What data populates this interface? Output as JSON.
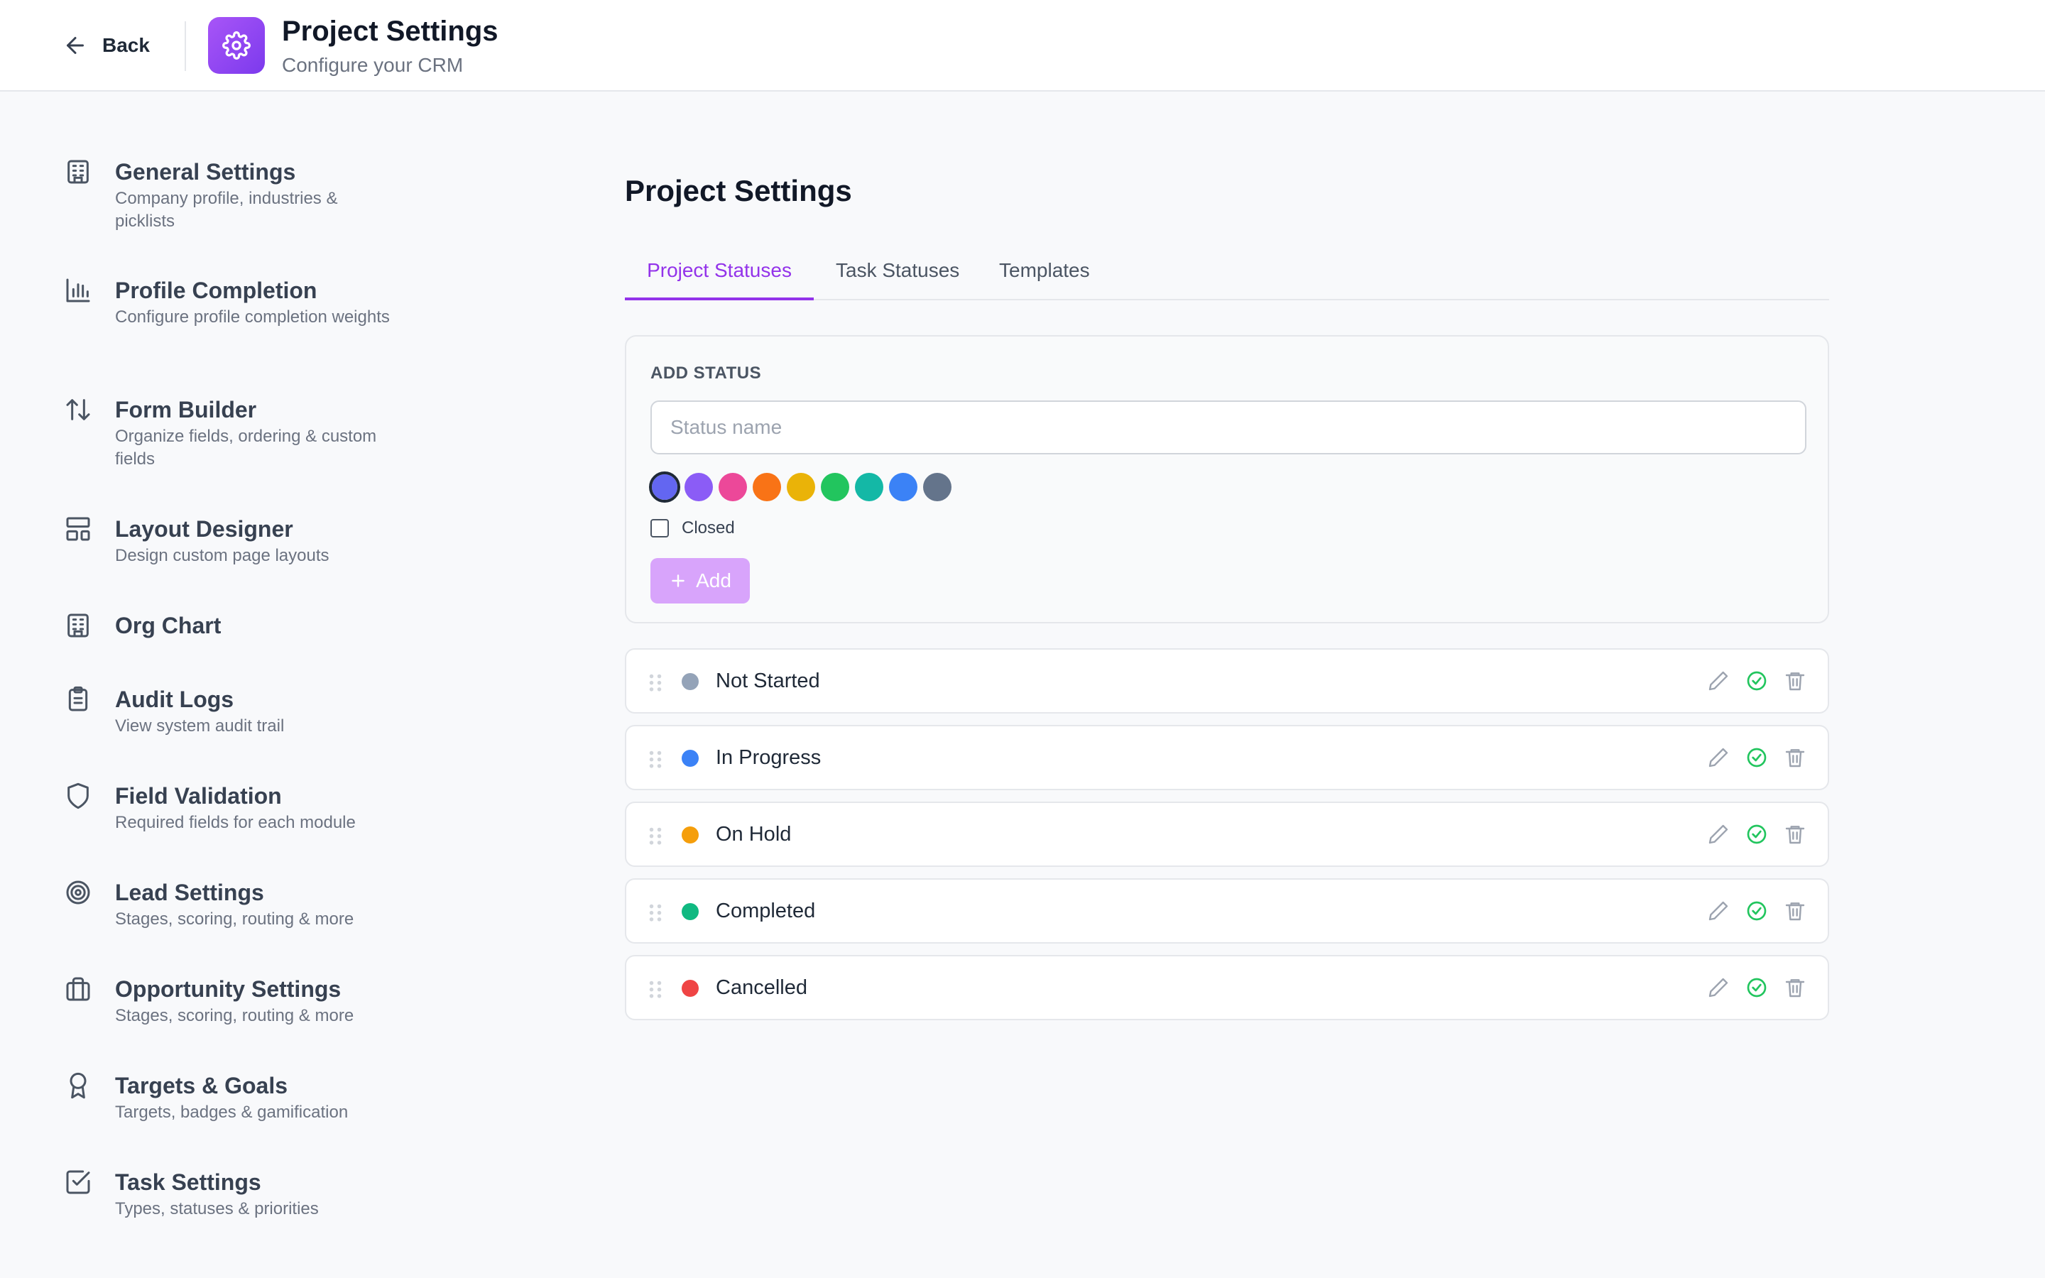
{
  "header": {
    "back_label": "Back",
    "title": "Project Settings",
    "subtitle": "Configure your CRM",
    "app_icon": "gear-icon"
  },
  "sidebar": {
    "items": [
      {
        "icon": "building-icon",
        "title": "General Settings",
        "desc": "Company profile, industries & picklists"
      },
      {
        "icon": "bar-chart-icon",
        "title": "Profile Completion",
        "desc": "Configure profile completion weights"
      },
      {
        "icon": "sort-arrows-icon",
        "title": "Form Builder",
        "desc": "Organize fields, ordering & custom fields"
      },
      {
        "icon": "layout-icon",
        "title": "Layout Designer",
        "desc": "Design custom page layouts"
      },
      {
        "icon": "building-icon",
        "title": "Org Chart",
        "desc": ""
      },
      {
        "icon": "clipboard-icon",
        "title": "Audit Logs",
        "desc": "View system audit trail"
      },
      {
        "icon": "shield-icon",
        "title": "Field Validation",
        "desc": "Required fields for each module"
      },
      {
        "icon": "target-icon",
        "title": "Lead Settings",
        "desc": "Stages, scoring, routing & more"
      },
      {
        "icon": "briefcase-icon",
        "title": "Opportunity Settings",
        "desc": "Stages, scoring, routing & more"
      },
      {
        "icon": "award-icon",
        "title": "Targets & Goals",
        "desc": "Targets, badges & gamification"
      },
      {
        "icon": "checkbox-icon",
        "title": "Task Settings",
        "desc": "Types, statuses & priorities"
      }
    ]
  },
  "main": {
    "title": "Project Settings",
    "tabs": [
      {
        "label": "Project Statuses",
        "active": true
      },
      {
        "label": "Task Statuses",
        "active": false
      },
      {
        "label": "Templates",
        "active": false
      }
    ],
    "add_status": {
      "label": "ADD STATUS",
      "placeholder": "Status name",
      "value": "",
      "colors": [
        "#6366f1",
        "#8b5cf6",
        "#ec4899",
        "#f97316",
        "#eab308",
        "#22c55e",
        "#14b8a6",
        "#3b82f6",
        "#64748b"
      ],
      "selected_color": "#6366f1",
      "closed_label": "Closed",
      "closed_checked": false,
      "add_label": "Add"
    },
    "statuses": [
      {
        "name": "Not Started",
        "color": "#94a3b8"
      },
      {
        "name": "In Progress",
        "color": "#3b82f6"
      },
      {
        "name": "On Hold",
        "color": "#f59e0b"
      },
      {
        "name": "Completed",
        "color": "#10b981"
      },
      {
        "name": "Cancelled",
        "color": "#ef4444"
      }
    ]
  },
  "colors": {
    "accent": "#9333ea",
    "close_action": "#22c55e"
  }
}
